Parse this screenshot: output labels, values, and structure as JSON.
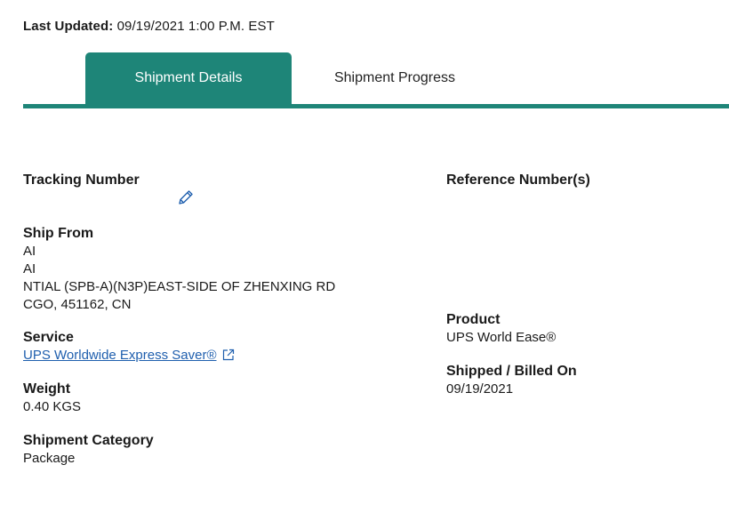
{
  "header": {
    "last_updated_label": "Last Updated:",
    "last_updated_value": "09/19/2021 1:00 P.M. EST"
  },
  "tabs": [
    {
      "label": "Shipment Details",
      "active": true
    },
    {
      "label": "Shipment Progress",
      "active": false
    }
  ],
  "details": {
    "tracking_number": {
      "label": "Tracking Number",
      "value": ""
    },
    "ship_from": {
      "label": "Ship From",
      "lines": [
        "AI",
        "AI",
        "NTIAL (SPB-A)(N3P)EAST-SIDE OF ZHENXING RD",
        "CGO, 451162, CN"
      ]
    },
    "service": {
      "label": "Service",
      "value": "UPS Worldwide Express Saver®"
    },
    "weight": {
      "label": "Weight",
      "value": "0.40 KGS"
    },
    "shipment_category": {
      "label": "Shipment Category",
      "value": "Package"
    },
    "reference_numbers": {
      "label": "Reference Number(s)"
    },
    "product": {
      "label": "Product",
      "value": "UPS World Ease®"
    },
    "shipped_billed_on": {
      "label": "Shipped / Billed On",
      "value": "09/19/2021"
    }
  },
  "icons": {
    "edit": "pencil-icon",
    "external_link": "external-link-icon"
  },
  "colors": {
    "accent": "#1e8578",
    "link": "#1f5fae"
  }
}
